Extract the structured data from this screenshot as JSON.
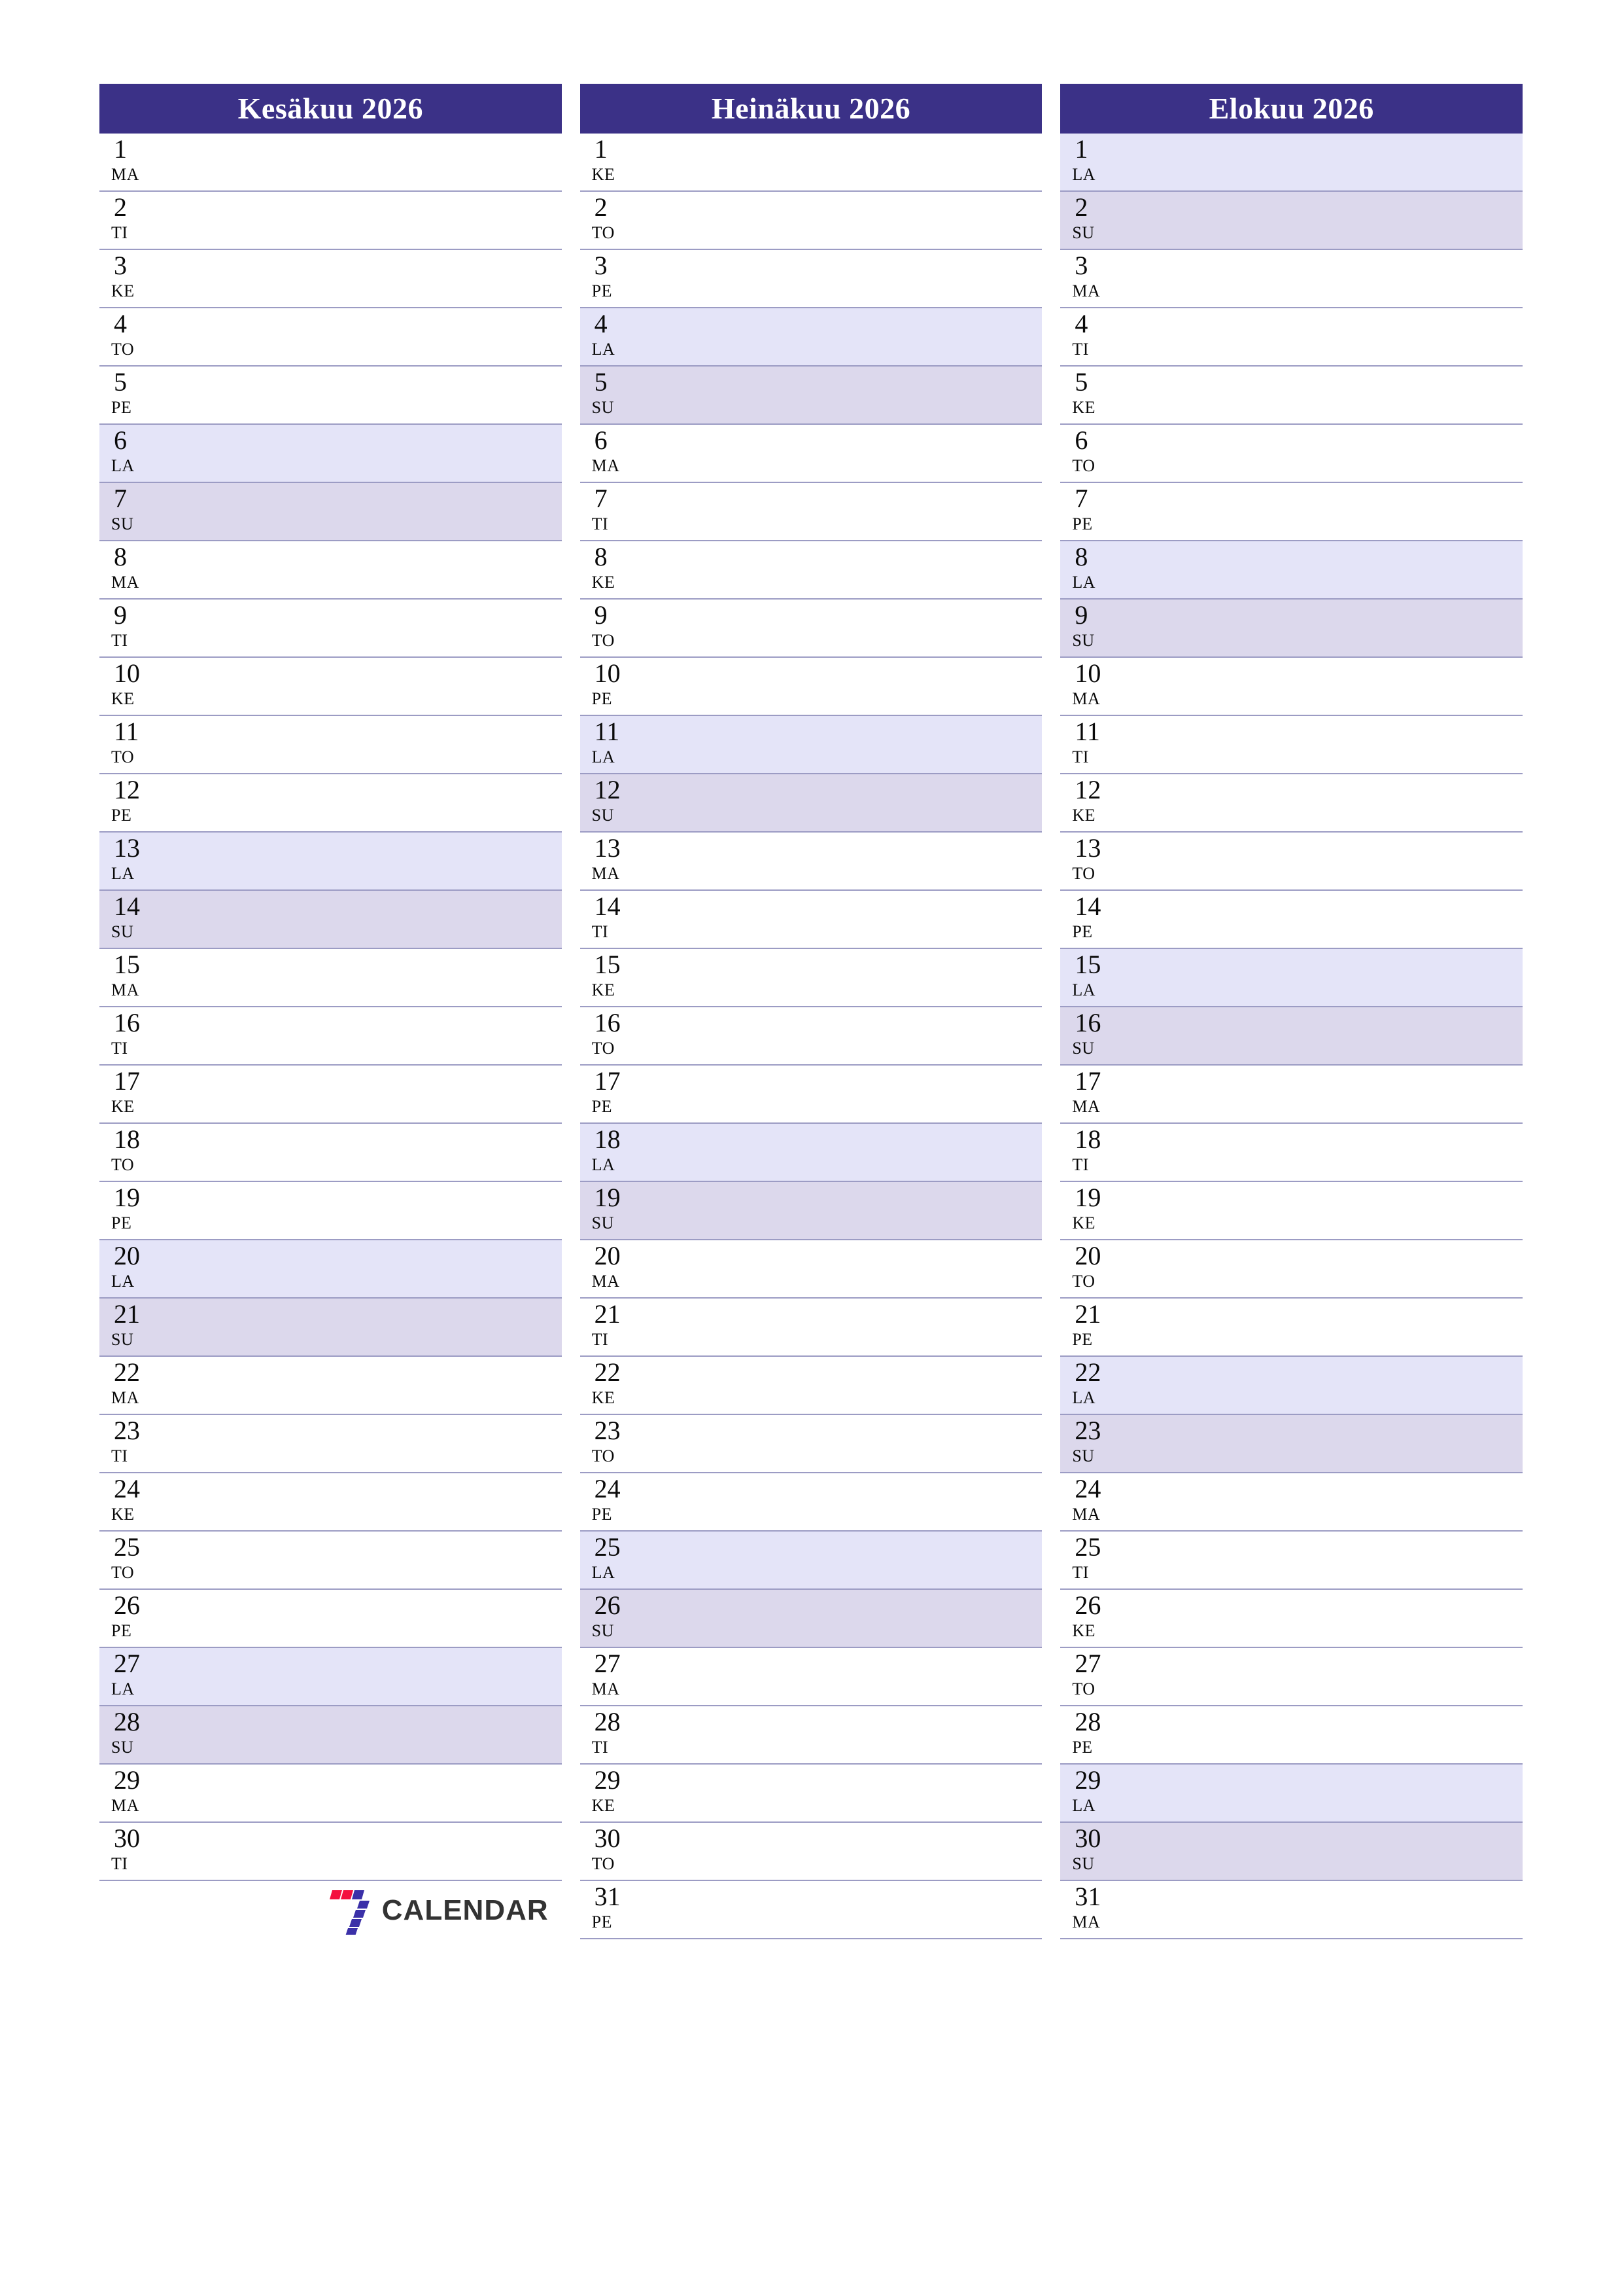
{
  "document": {
    "type": "printable-monthly-planner",
    "year": "2026",
    "language": "fi"
  },
  "colors": {
    "header_bg": "#3b3187",
    "header_text": "#ffffff",
    "saturday_bg": "#e4e4f8",
    "sunday_bg": "#dcd8ec",
    "row_line": "#9c9cc4",
    "page_bg": "#ffffff",
    "logo_red": "#f4113f",
    "logo_indigo": "#3b30a8",
    "logo_text": "#333333"
  },
  "logo": {
    "mark_name": "seven-stripes-mark",
    "text": "CALENDAR"
  },
  "months": [
    {
      "title": "Kesäkuu 2026",
      "days": [
        {
          "num": "1",
          "wd": "MA",
          "type": "weekday"
        },
        {
          "num": "2",
          "wd": "TI",
          "type": "weekday"
        },
        {
          "num": "3",
          "wd": "KE",
          "type": "weekday"
        },
        {
          "num": "4",
          "wd": "TO",
          "type": "weekday"
        },
        {
          "num": "5",
          "wd": "PE",
          "type": "weekday"
        },
        {
          "num": "6",
          "wd": "LA",
          "type": "sat"
        },
        {
          "num": "7",
          "wd": "SU",
          "type": "sun"
        },
        {
          "num": "8",
          "wd": "MA",
          "type": "weekday"
        },
        {
          "num": "9",
          "wd": "TI",
          "type": "weekday"
        },
        {
          "num": "10",
          "wd": "KE",
          "type": "weekday"
        },
        {
          "num": "11",
          "wd": "TO",
          "type": "weekday"
        },
        {
          "num": "12",
          "wd": "PE",
          "type": "weekday"
        },
        {
          "num": "13",
          "wd": "LA",
          "type": "sat"
        },
        {
          "num": "14",
          "wd": "SU",
          "type": "sun"
        },
        {
          "num": "15",
          "wd": "MA",
          "type": "weekday"
        },
        {
          "num": "16",
          "wd": "TI",
          "type": "weekday"
        },
        {
          "num": "17",
          "wd": "KE",
          "type": "weekday"
        },
        {
          "num": "18",
          "wd": "TO",
          "type": "weekday"
        },
        {
          "num": "19",
          "wd": "PE",
          "type": "weekday"
        },
        {
          "num": "20",
          "wd": "LA",
          "type": "sat"
        },
        {
          "num": "21",
          "wd": "SU",
          "type": "sun"
        },
        {
          "num": "22",
          "wd": "MA",
          "type": "weekday"
        },
        {
          "num": "23",
          "wd": "TI",
          "type": "weekday"
        },
        {
          "num": "24",
          "wd": "KE",
          "type": "weekday"
        },
        {
          "num": "25",
          "wd": "TO",
          "type": "weekday"
        },
        {
          "num": "26",
          "wd": "PE",
          "type": "weekday"
        },
        {
          "num": "27",
          "wd": "LA",
          "type": "sat"
        },
        {
          "num": "28",
          "wd": "SU",
          "type": "sun"
        },
        {
          "num": "29",
          "wd": "MA",
          "type": "weekday"
        },
        {
          "num": "30",
          "wd": "TI",
          "type": "weekday"
        }
      ],
      "has_logo_row": true
    },
    {
      "title": "Heinäkuu 2026",
      "days": [
        {
          "num": "1",
          "wd": "KE",
          "type": "weekday"
        },
        {
          "num": "2",
          "wd": "TO",
          "type": "weekday"
        },
        {
          "num": "3",
          "wd": "PE",
          "type": "weekday"
        },
        {
          "num": "4",
          "wd": "LA",
          "type": "sat"
        },
        {
          "num": "5",
          "wd": "SU",
          "type": "sun"
        },
        {
          "num": "6",
          "wd": "MA",
          "type": "weekday"
        },
        {
          "num": "7",
          "wd": "TI",
          "type": "weekday"
        },
        {
          "num": "8",
          "wd": "KE",
          "type": "weekday"
        },
        {
          "num": "9",
          "wd": "TO",
          "type": "weekday"
        },
        {
          "num": "10",
          "wd": "PE",
          "type": "weekday"
        },
        {
          "num": "11",
          "wd": "LA",
          "type": "sat"
        },
        {
          "num": "12",
          "wd": "SU",
          "type": "sun"
        },
        {
          "num": "13",
          "wd": "MA",
          "type": "weekday"
        },
        {
          "num": "14",
          "wd": "TI",
          "type": "weekday"
        },
        {
          "num": "15",
          "wd": "KE",
          "type": "weekday"
        },
        {
          "num": "16",
          "wd": "TO",
          "type": "weekday"
        },
        {
          "num": "17",
          "wd": "PE",
          "type": "weekday"
        },
        {
          "num": "18",
          "wd": "LA",
          "type": "sat"
        },
        {
          "num": "19",
          "wd": "SU",
          "type": "sun"
        },
        {
          "num": "20",
          "wd": "MA",
          "type": "weekday"
        },
        {
          "num": "21",
          "wd": "TI",
          "type": "weekday"
        },
        {
          "num": "22",
          "wd": "KE",
          "type": "weekday"
        },
        {
          "num": "23",
          "wd": "TO",
          "type": "weekday"
        },
        {
          "num": "24",
          "wd": "PE",
          "type": "weekday"
        },
        {
          "num": "25",
          "wd": "LA",
          "type": "sat"
        },
        {
          "num": "26",
          "wd": "SU",
          "type": "sun"
        },
        {
          "num": "27",
          "wd": "MA",
          "type": "weekday"
        },
        {
          "num": "28",
          "wd": "TI",
          "type": "weekday"
        },
        {
          "num": "29",
          "wd": "KE",
          "type": "weekday"
        },
        {
          "num": "30",
          "wd": "TO",
          "type": "weekday"
        },
        {
          "num": "31",
          "wd": "PE",
          "type": "weekday"
        }
      ],
      "has_logo_row": false
    },
    {
      "title": "Elokuu 2026",
      "days": [
        {
          "num": "1",
          "wd": "LA",
          "type": "sat"
        },
        {
          "num": "2",
          "wd": "SU",
          "type": "sun"
        },
        {
          "num": "3",
          "wd": "MA",
          "type": "weekday"
        },
        {
          "num": "4",
          "wd": "TI",
          "type": "weekday"
        },
        {
          "num": "5",
          "wd": "KE",
          "type": "weekday"
        },
        {
          "num": "6",
          "wd": "TO",
          "type": "weekday"
        },
        {
          "num": "7",
          "wd": "PE",
          "type": "weekday"
        },
        {
          "num": "8",
          "wd": "LA",
          "type": "sat"
        },
        {
          "num": "9",
          "wd": "SU",
          "type": "sun"
        },
        {
          "num": "10",
          "wd": "MA",
          "type": "weekday"
        },
        {
          "num": "11",
          "wd": "TI",
          "type": "weekday"
        },
        {
          "num": "12",
          "wd": "KE",
          "type": "weekday"
        },
        {
          "num": "13",
          "wd": "TO",
          "type": "weekday"
        },
        {
          "num": "14",
          "wd": "PE",
          "type": "weekday"
        },
        {
          "num": "15",
          "wd": "LA",
          "type": "sat"
        },
        {
          "num": "16",
          "wd": "SU",
          "type": "sun"
        },
        {
          "num": "17",
          "wd": "MA",
          "type": "weekday"
        },
        {
          "num": "18",
          "wd": "TI",
          "type": "weekday"
        },
        {
          "num": "19",
          "wd": "KE",
          "type": "weekday"
        },
        {
          "num": "20",
          "wd": "TO",
          "type": "weekday"
        },
        {
          "num": "21",
          "wd": "PE",
          "type": "weekday"
        },
        {
          "num": "22",
          "wd": "LA",
          "type": "sat"
        },
        {
          "num": "23",
          "wd": "SU",
          "type": "sun"
        },
        {
          "num": "24",
          "wd": "MA",
          "type": "weekday"
        },
        {
          "num": "25",
          "wd": "TI",
          "type": "weekday"
        },
        {
          "num": "26",
          "wd": "KE",
          "type": "weekday"
        },
        {
          "num": "27",
          "wd": "TO",
          "type": "weekday"
        },
        {
          "num": "28",
          "wd": "PE",
          "type": "weekday"
        },
        {
          "num": "29",
          "wd": "LA",
          "type": "sat"
        },
        {
          "num": "30",
          "wd": "SU",
          "type": "sun"
        },
        {
          "num": "31",
          "wd": "MA",
          "type": "weekday"
        }
      ],
      "has_logo_row": false
    }
  ]
}
